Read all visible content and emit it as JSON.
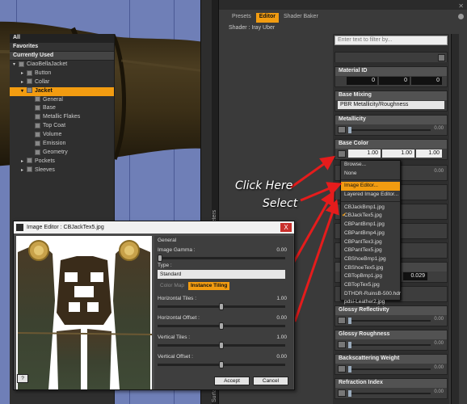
{
  "pane": {
    "tabs": [
      {
        "label": "Presets",
        "active": false
      },
      {
        "label": "Editor",
        "active": true
      },
      {
        "label": "Shader Baker",
        "active": false
      }
    ],
    "shader_line": "Shader : Iray Uber",
    "side_tab_label": "Parameters",
    "side_tab_label2": "Surface Se",
    "filter_placeholder": "Enter text to filter by..."
  },
  "tree": {
    "headers": [
      "All",
      "Favorites",
      "Currently Used"
    ],
    "rows": [
      {
        "label": "CiaoBellaJacket",
        "depth": 0,
        "selected": false
      },
      {
        "label": "Button",
        "depth": 1,
        "selected": false
      },
      {
        "label": "Collar",
        "depth": 1,
        "selected": false
      },
      {
        "label": "Jacket",
        "depth": 1,
        "selected": true
      },
      {
        "label": "General",
        "depth": 2,
        "selected": false
      },
      {
        "label": "Base",
        "depth": 2,
        "selected": false
      },
      {
        "label": "Metallic Flakes",
        "depth": 2,
        "selected": false
      },
      {
        "label": "Top Coat",
        "depth": 2,
        "selected": false
      },
      {
        "label": "Volume",
        "depth": 2,
        "selected": false
      },
      {
        "label": "Emission",
        "depth": 2,
        "selected": false
      },
      {
        "label": "Geometry",
        "depth": 2,
        "selected": false
      },
      {
        "label": "Pockets",
        "depth": 1,
        "selected": false
      },
      {
        "label": "Sleeves",
        "depth": 1,
        "selected": false
      }
    ]
  },
  "params": {
    "material_id": {
      "title": "Material ID",
      "values": [
        "0",
        "0",
        "0"
      ]
    },
    "base_mixing": {
      "title": "Base Mixing",
      "value": "PBR Metallicity/Roughness"
    },
    "metallicity": {
      "title": "Metallicity",
      "value": "0.00",
      "level": 0.0
    },
    "base_color": {
      "title": "Base Color",
      "values": [
        "1.00",
        "1.00",
        "1.00"
      ]
    },
    "below_menu_value": "0.029",
    "glossy_reflectivity": {
      "title": "Glossy Reflectivity",
      "value": "0.00",
      "level": 0.0
    },
    "glossy_roughness": {
      "title": "Glossy Roughness",
      "value": "0.00",
      "level": 0.0
    },
    "backscattering_weight": {
      "title": "Backscattering Weight",
      "value": "0.00",
      "level": 0.0
    },
    "refraction_index": {
      "title": "Refraction Index",
      "value": "0.00",
      "level": 0.0
    }
  },
  "image_menu": {
    "items": [
      {
        "label": "Browse...",
        "highlight": false,
        "checked": false
      },
      {
        "label": "None",
        "highlight": false,
        "checked": false
      },
      {
        "label": "Image Editor...",
        "highlight": true,
        "checked": false
      },
      {
        "label": "Layered Image Editor...",
        "highlight": false,
        "checked": false
      },
      {
        "label": "CBJackBmp1.jpg",
        "highlight": false,
        "checked": false
      },
      {
        "label": "CBJackTex5.jpg",
        "highlight": false,
        "checked": true
      },
      {
        "label": "CBPantBmp1.jpg",
        "highlight": false,
        "checked": false
      },
      {
        "label": "CBPantBmp4.jpg",
        "highlight": false,
        "checked": false
      },
      {
        "label": "CBPantTex3.jpg",
        "highlight": false,
        "checked": false
      },
      {
        "label": "CBPantTex5.jpg",
        "highlight": false,
        "checked": false
      },
      {
        "label": "CBShoeBmp1.jpg",
        "highlight": false,
        "checked": false
      },
      {
        "label": "CBShoeTex5.jpg",
        "highlight": false,
        "checked": false
      },
      {
        "label": "CBTopBmp1.jpg",
        "highlight": false,
        "checked": false
      },
      {
        "label": "CBTopTex5.jpg",
        "highlight": false,
        "checked": false
      },
      {
        "label": "DTHDR-RuinsB-500.hdr",
        "highlight": false,
        "checked": false
      },
      {
        "label": "pdsi-Leather2.jpg",
        "highlight": false,
        "checked": false
      }
    ]
  },
  "annotations": {
    "click_here": "Click Here",
    "select": "Select"
  },
  "dialog": {
    "title": "Image Editor : CBJackTex5.jpg",
    "close_label": "X",
    "general_label": "General",
    "image_gamma_label": "Image Gamma :",
    "image_gamma_value": "0.00",
    "type_label": "Type :",
    "type_value": "Standard",
    "subtabs": [
      {
        "label": "Color Map",
        "active": false
      },
      {
        "label": "Instance Tiling",
        "active": true
      }
    ],
    "horizontal_tiles_label": "Horizontal Tiles :",
    "horizontal_tiles_value": "1.00",
    "horizontal_offset_label": "Horizontal Offset :",
    "horizontal_offset_value": "0.00",
    "vertical_tiles_label": "Vertical Tiles :",
    "vertical_tiles_value": "1.00",
    "vertical_offset_label": "Vertical Offset :",
    "vertical_offset_value": "0.00",
    "help_label": "?",
    "accept_label": "Accept",
    "cancel_label": "Cancel"
  },
  "colors": {
    "accent": "#f29c11",
    "viewport_bg": "#6f7fb7",
    "leather": "#3a2f18",
    "arrow": "#e51c1c",
    "uv_fabric": "#3f4a36"
  }
}
